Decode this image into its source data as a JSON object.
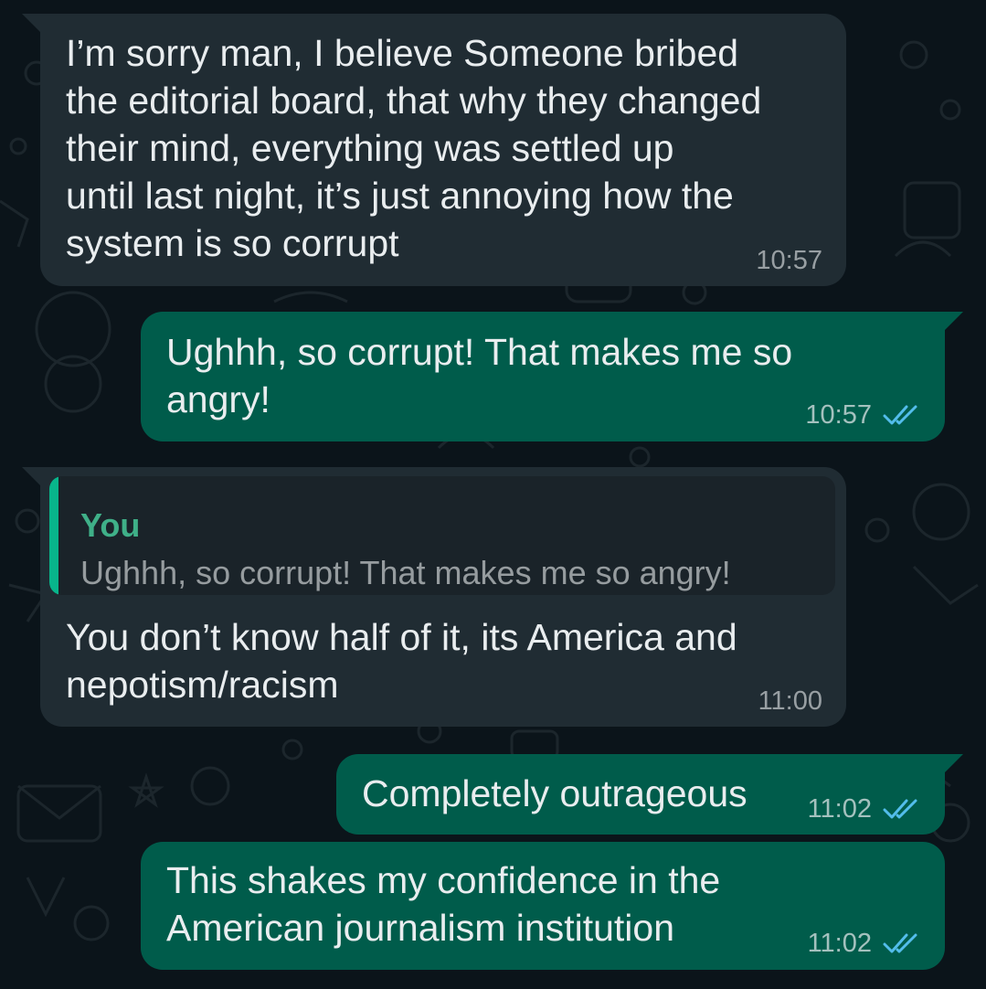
{
  "colors": {
    "background": "#0b141a",
    "incoming_bubble": "#202c33",
    "outgoing_bubble": "#005c4b",
    "read_tick": "#53bdeb",
    "quote_accent": "#06cf9c"
  },
  "messages": [
    {
      "direction": "incoming",
      "text": "I’m sorry man, I believe Someone bribed\nthe editorial board, that why they changed\ntheir mind,  everything was settled up\nuntil last night, it’s just annoying how the\nsystem is so corrupt",
      "time": "10:57"
    },
    {
      "direction": "outgoing",
      "text": "Ughhh, so corrupt! That makes me so\nangry!",
      "time": "10:57",
      "status_icon": "double-check-read-icon"
    },
    {
      "direction": "incoming",
      "reply_to": {
        "author": "You",
        "text": "Ughhh, so corrupt! That makes me so angry!"
      },
      "text": "You don’t know half of it, its America and\nnepotism/racism",
      "time": "11:00"
    },
    {
      "direction": "outgoing",
      "text": "Completely outrageous",
      "time": "11:02",
      "status_icon": "double-check-read-icon"
    },
    {
      "direction": "outgoing",
      "text": "This shakes my confidence in the\nAmerican journalism institution",
      "time": "11:02",
      "status_icon": "double-check-read-icon"
    }
  ]
}
